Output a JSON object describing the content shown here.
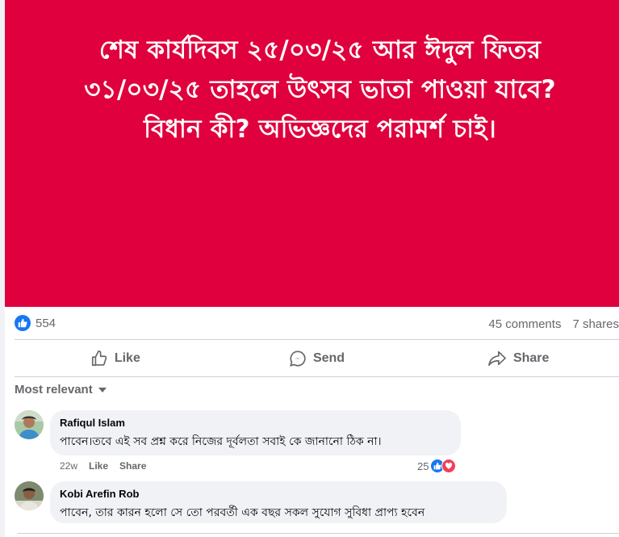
{
  "post": {
    "headline_lines": [
      "শেষ কার্যদিবস ২৫/০৩/২৫ আর ঈদুল ফিতর",
      "৩১/০৩/২৫ তাহলে উৎসব ভাতা পাওয়া যাবে?",
      "বিধান কী? অভিজ্ঞদের পরামর্শ চাই।"
    ],
    "background_color": "#e0003d",
    "text_color": "#ffffff"
  },
  "stats": {
    "like_count": "554",
    "comments": "45 comments",
    "shares": "7 shares"
  },
  "actions": {
    "like": "Like",
    "send": "Send",
    "share": "Share"
  },
  "filter": {
    "label": "Most relevant"
  },
  "comments": [
    {
      "author": "Rafiqul Islam",
      "text": "পাবেন।তবে এই সব প্রশ্ন করে নিজের দূর্বলতা সবাই কে জানানো ঠিক না।",
      "time": "22w",
      "like": "Like",
      "share": "Share",
      "reaction_count": "25"
    },
    {
      "author": "Kobi Arefin Rob",
      "text": "পাবেন, তার কারন হলো সে তো পরবর্তী এক বছর সকল সুযোগ সুবিধা প্রাপ্য হবেন"
    }
  ],
  "colors": {
    "accent": "#1877f2",
    "love": "#f33e58",
    "muted": "#65676b",
    "bubble": "#f0f2f5"
  },
  "icons": [
    "like-icon",
    "send-icon",
    "share-icon",
    "chevron-down-icon",
    "love-icon"
  ]
}
